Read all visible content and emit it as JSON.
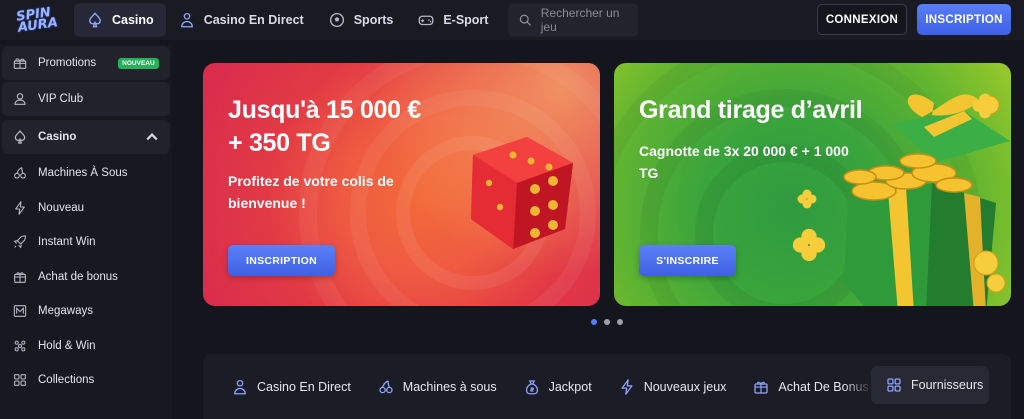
{
  "brand": {
    "logo_line1": "SPIN",
    "logo_line2": "AURA"
  },
  "topnav": {
    "items": [
      {
        "label": "Casino",
        "icon": "spade-icon",
        "active": true
      },
      {
        "label": "Casino En Direct",
        "icon": "dealer-icon"
      },
      {
        "label": "Sports",
        "icon": "soccer-ball-icon"
      },
      {
        "label": "E-Sport",
        "icon": "gamepad-icon"
      }
    ],
    "search_placeholder": "Rechercher un jeu",
    "login_label": "CONNEXION",
    "register_label": "INSCRIPTION"
  },
  "sidebar": {
    "items": [
      {
        "label": "Promotions",
        "icon": "gift-icon",
        "badge": "NOUVEAU"
      },
      {
        "label": "VIP Club",
        "icon": "user-icon"
      },
      {
        "label": "Casino",
        "icon": "spade-icon",
        "expanded": true
      },
      {
        "label": "Machines À Sous",
        "icon": "cherries-icon"
      },
      {
        "label": "Nouveau",
        "icon": "lightning-icon"
      },
      {
        "label": "Instant Win",
        "icon": "rocket-icon"
      },
      {
        "label": "Achat de bonus",
        "icon": "gift-box-icon"
      },
      {
        "label": "Megaways",
        "icon": "megaways-icon"
      },
      {
        "label": "Hold & Win",
        "icon": "dots-icon"
      },
      {
        "label": "Collections",
        "icon": "grid-icon"
      }
    ]
  },
  "banners": [
    {
      "title_line1": "Jusqu'à 15 000 €",
      "title_line2": "+ 350 TG",
      "sub_line1": "Profitez de votre colis de",
      "sub_line2": "bienvenue !",
      "button": "INSCRIPTION",
      "image": "red-dice"
    },
    {
      "title_line1": "Grand tirage d’avril",
      "sub_line1": "Cagnotte de 3x 20 000 € + 1 000",
      "sub_line2": "TG",
      "button": "S'INSCRIRE",
      "image": "green-gift-box-with-coins"
    }
  ],
  "carousel": {
    "count": 3,
    "active_index": 0
  },
  "categories": [
    {
      "label": "Casino En Direct",
      "icon": "dealer-icon"
    },
    {
      "label": "Machines à sous",
      "icon": "cherries-icon"
    },
    {
      "label": "Jackpot",
      "icon": "money-bag-icon"
    },
    {
      "label": "Nouveaux jeux",
      "icon": "lightning-icon"
    },
    {
      "label": "Achat De Bonus",
      "icon": "gift-box-icon"
    },
    {
      "label": "Fournisseurs",
      "icon": "grid-icon"
    }
  ],
  "colors": {
    "accent": "#4e71f0",
    "badge": "#27b05a",
    "background": "#15161d"
  }
}
